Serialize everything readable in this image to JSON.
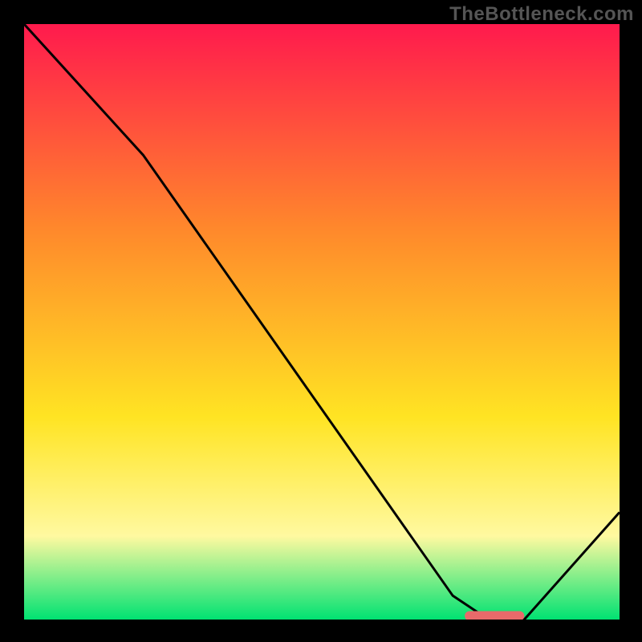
{
  "watermark": "TheBottleneck.com",
  "colors": {
    "background": "#000000",
    "watermark": "#555555",
    "gradient_top": "#ff1a4d",
    "gradient_mid_upper": "#ff8a2b",
    "gradient_mid": "#ffe423",
    "gradient_mid_lower": "#fff9a0",
    "gradient_bottom": "#00e272",
    "curve": "#000000",
    "marker": "#e86a6a"
  },
  "chart_data": {
    "type": "line",
    "title": "",
    "xlabel": "",
    "ylabel": "",
    "xlim": [
      0,
      100
    ],
    "ylim": [
      0,
      100
    ],
    "grid": false,
    "legend": false,
    "series": [
      {
        "name": "bottleneck-curve",
        "x": [
          0,
          20,
          72,
          78,
          84,
          100
        ],
        "y": [
          100,
          78,
          4,
          0,
          0,
          18
        ]
      }
    ],
    "marker": {
      "x_start": 74,
      "x_end": 84,
      "y": 0.6,
      "shape": "rounded-bar"
    },
    "annotations": []
  }
}
